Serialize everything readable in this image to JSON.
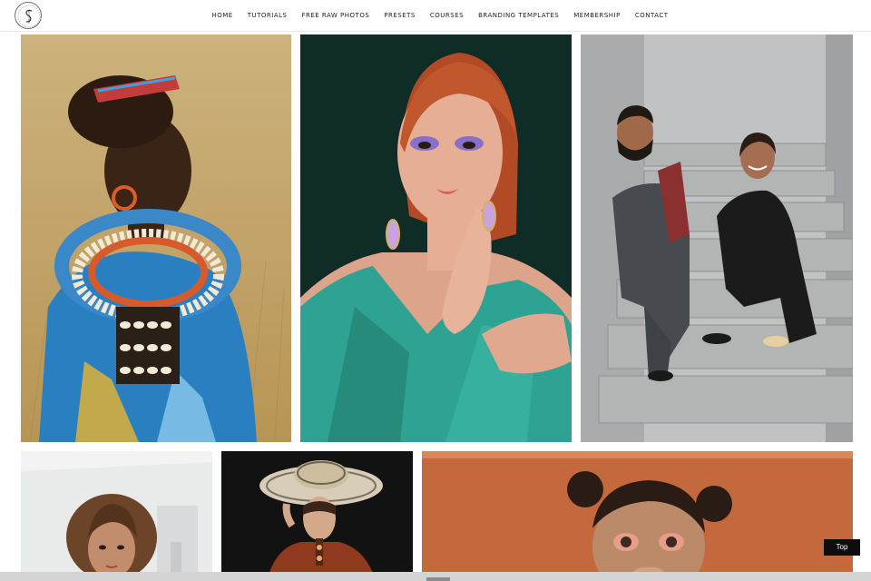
{
  "header": {
    "logo_icon": "monogram-s-icon",
    "nav": [
      {
        "label": "HOME"
      },
      {
        "label": "TUTORIALS"
      },
      {
        "label": "FREE RAW PHOTOS"
      },
      {
        "label": "PRESETS"
      },
      {
        "label": "COURSES"
      },
      {
        "label": "BRANDING TEMPLATES"
      },
      {
        "label": "MEMBERSHIP"
      },
      {
        "label": "CONTACT"
      }
    ]
  },
  "photos": [
    {
      "name": "photo-beaded-necklace-woman",
      "bg": "#c9ad73"
    },
    {
      "name": "photo-teal-dress-woman",
      "bg": "#0e2a24"
    },
    {
      "name": "photo-couple-stairs",
      "bg": "#b9bbbc"
    },
    {
      "name": "photo-curly-hair-woman",
      "bg": "#e6e6e6"
    },
    {
      "name": "photo-sombrero-woman",
      "bg": "#121212"
    },
    {
      "name": "photo-space-buns-woman",
      "bg": "#c46a3f"
    }
  ],
  "top_button": {
    "label": "Top"
  }
}
